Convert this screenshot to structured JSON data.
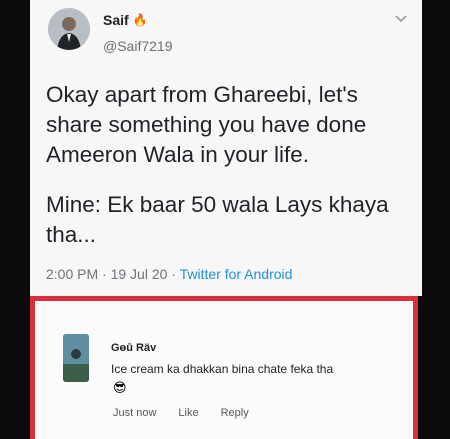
{
  "tweet": {
    "author_name": "Saif",
    "author_emoji": "🔥",
    "handle": "@Saif7219",
    "paragraphs": [
      "Okay apart from Ghareebi, let's share something you have done Ameeron Wala in your life.",
      "Mine: Ek baar 50 wala Lays khaya tha..."
    ],
    "timestamp": "2:00 PM · 19 Jul 20 · ",
    "source": "Twitter for Android",
    "menu_icon": "chevron-down-icon"
  },
  "comment": {
    "author_name": "Gөū Räv",
    "text": "Ice cream ka dhakkan bina chate feka tha",
    "emoji": "😎",
    "actions": {
      "time": "Just now",
      "like": "Like",
      "reply": "Reply"
    }
  },
  "colors": {
    "background": "#0b0b0b",
    "card": "#f7f7f7",
    "link": "#1f8fe0",
    "highlight_border": "#d8303a"
  }
}
